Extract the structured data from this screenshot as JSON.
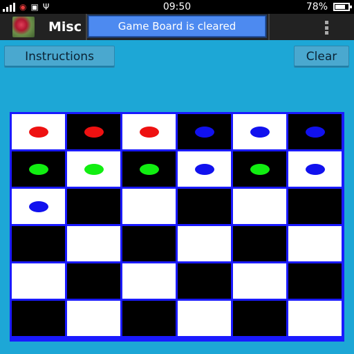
{
  "status_bar": {
    "time": "09:50",
    "battery_percent": "78%",
    "battery_level": 0.78,
    "icons": [
      "signal-icon",
      "wifi-icon",
      "image-icon",
      "usb-icon"
    ]
  },
  "action_bar": {
    "app_title": "Misc",
    "toast": "Game Board is cleared",
    "menu_icon": "overflow-menu-icon"
  },
  "buttons": {
    "instructions": "Instructions",
    "clear": "Clear"
  },
  "colors": {
    "background": "#1da7d6",
    "board_border": "#1a1aff",
    "red": "#ee1111",
    "green": "#11ee11",
    "blue": "#1111ee"
  },
  "board": {
    "rows": 6,
    "cols": 6,
    "first_cell": "light",
    "pieces": [
      [
        "red",
        "red",
        "red",
        "blue",
        "blue",
        "blue"
      ],
      [
        "green",
        "green",
        "green",
        "blue",
        "green",
        "blue"
      ],
      [
        "blue",
        null,
        null,
        null,
        null,
        null
      ],
      [
        null,
        null,
        null,
        null,
        null,
        null
      ],
      [
        null,
        null,
        null,
        null,
        null,
        null
      ],
      [
        null,
        null,
        null,
        null,
        null,
        null
      ]
    ]
  }
}
